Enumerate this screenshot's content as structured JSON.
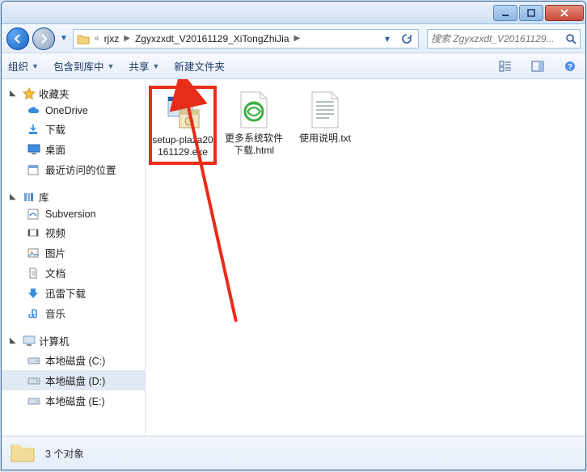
{
  "breadcrumb": {
    "prefix": "«",
    "level1": "rjxz",
    "level2": "Zgyxzxdt_V20161129_XiTongZhiJia"
  },
  "search": {
    "placeholder": "搜索 Zgyxzxdt_V20161129..."
  },
  "toolbar": {
    "organize": "组织",
    "include": "包含到库中",
    "share": "共享",
    "newfolder": "新建文件夹"
  },
  "sidebar": {
    "favorites": {
      "label": "收藏夹",
      "items": [
        {
          "label": "OneDrive"
        },
        {
          "label": "下载"
        },
        {
          "label": "桌面"
        },
        {
          "label": "最近访问的位置"
        }
      ]
    },
    "libraries": {
      "label": "库",
      "items": [
        {
          "label": "Subversion"
        },
        {
          "label": "视频"
        },
        {
          "label": "图片"
        },
        {
          "label": "文档"
        },
        {
          "label": "迅雷下载"
        },
        {
          "label": "音乐"
        }
      ]
    },
    "computer": {
      "label": "计算机",
      "items": [
        {
          "label": "本地磁盘 (C:)"
        },
        {
          "label": "本地磁盘 (D:)"
        },
        {
          "label": "本地磁盘 (E:)"
        }
      ]
    }
  },
  "files": [
    {
      "label": "setup-plaza20161129.exe"
    },
    {
      "label": "更多系统软件下载.html"
    },
    {
      "label": "使用说明.txt"
    }
  ],
  "status": {
    "text": "3 个对象"
  }
}
